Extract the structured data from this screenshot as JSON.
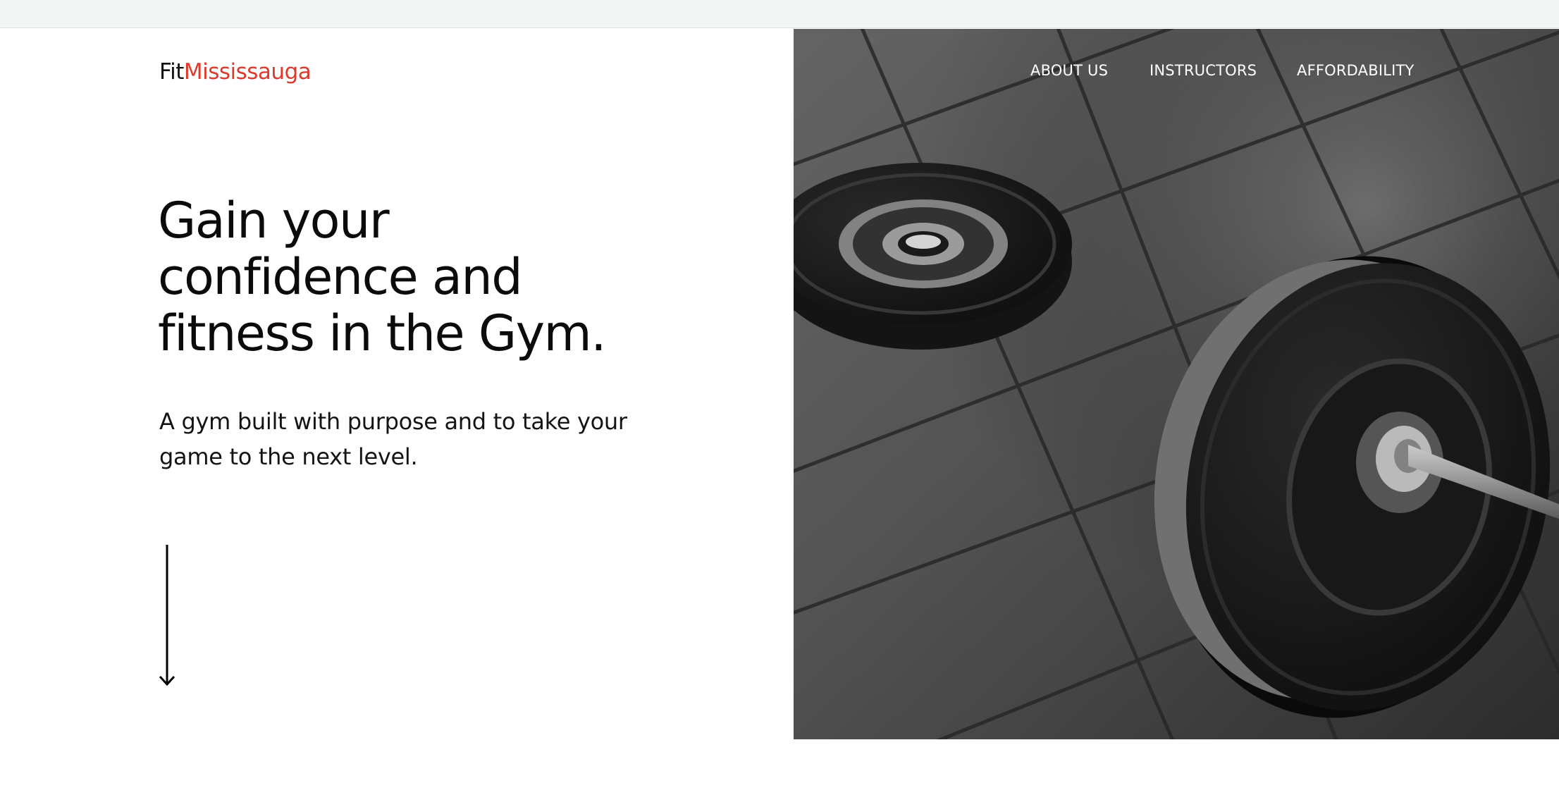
{
  "brand": {
    "name_prefix": "Fit",
    "name_accent": "Mississauga",
    "accent_color": "#dd3a2c"
  },
  "nav": {
    "items": [
      {
        "label": "ABOUT US"
      },
      {
        "label": "INSTRUCTORS"
      },
      {
        "label": "AFFORDABILITY"
      }
    ]
  },
  "hero": {
    "title_line1": "Gain your",
    "title_line2": "confidence and",
    "title_line3": "fitness in the Gym.",
    "subtitle_line1": "A gym built with purpose and to take your",
    "subtitle_line2": "game to the next level.",
    "scroll_icon": "arrow-down-icon",
    "image_icon": "barbell-photo"
  }
}
